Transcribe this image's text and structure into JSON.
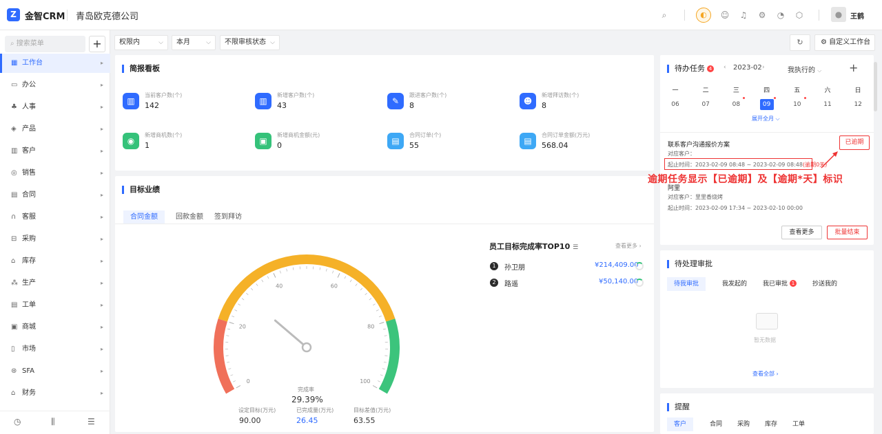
{
  "app": {
    "logo": "Z",
    "name": "金智CRM",
    "company": "青岛欧克德公司",
    "user": "王鹤"
  },
  "topbar_icons": [
    "search-icon",
    "megaphone-icon",
    "contacts-icon",
    "bell-icon",
    "settings-icon",
    "pie-chart-icon",
    "package-icon"
  ],
  "sidebar": {
    "search_placeholder": "搜索菜单",
    "add_label": "+",
    "items": [
      {
        "label": "工作台",
        "icon": "dashboard-icon",
        "active": true
      },
      {
        "label": "办公",
        "icon": "office-icon"
      },
      {
        "label": "人事",
        "icon": "people-icon"
      },
      {
        "label": "产品",
        "icon": "product-icon"
      },
      {
        "label": "客户",
        "icon": "customer-icon"
      },
      {
        "label": "销售",
        "icon": "sales-icon"
      },
      {
        "label": "合同",
        "icon": "contract-icon"
      },
      {
        "label": "客服",
        "icon": "headset-icon"
      },
      {
        "label": "采购",
        "icon": "purchase-icon"
      },
      {
        "label": "库存",
        "icon": "warehouse-icon"
      },
      {
        "label": "生产",
        "icon": "production-icon"
      },
      {
        "label": "工单",
        "icon": "ticket-icon"
      },
      {
        "label": "商城",
        "icon": "store-icon"
      },
      {
        "label": "市场",
        "icon": "market-icon"
      },
      {
        "label": "SFA",
        "icon": "sfa-icon"
      },
      {
        "label": "财务",
        "icon": "finance-icon"
      }
    ]
  },
  "filters": {
    "scope": "权限内",
    "period": "本月",
    "audit": "不限审核状态"
  },
  "toolbar": {
    "custom_label": "自定义工作台"
  },
  "briefing": {
    "title": "简报看板",
    "stats": [
      {
        "label": "当前客户数(个)",
        "value": "142",
        "color": "#2f6bff"
      },
      {
        "label": "新增客户数(个)",
        "value": "43",
        "color": "#2f6bff"
      },
      {
        "label": "跟进客户数(个)",
        "value": "8",
        "color": "#2f6bff"
      },
      {
        "label": "新增拜访数(个)",
        "value": "8",
        "color": "#2f6bff"
      },
      {
        "label": "新增商机数(个)",
        "value": "1",
        "color": "#35c27a"
      },
      {
        "label": "新增商机金额(元)",
        "value": "0",
        "color": "#35c27a"
      },
      {
        "label": "合同订单(个)",
        "value": "55",
        "color": "#3ea8f5"
      },
      {
        "label": "合同订单金额(万元)",
        "value": "568.04",
        "color": "#3ea8f5"
      }
    ]
  },
  "target": {
    "title": "目标业绩",
    "tabs": [
      "合同金额",
      "回款金额",
      "签到拜访"
    ],
    "gauge": {
      "ticks": [
        "0",
        "20",
        "40",
        "60",
        "80",
        "100"
      ],
      "center_label": "完成率",
      "center_value": "29.39%",
      "percent": 29.39,
      "colors": {
        "low": "#f0705a",
        "mid": "#f5b128",
        "high": "#3cc47c"
      }
    },
    "summary": [
      {
        "label": "设定目标(万元)",
        "value": "90.00"
      },
      {
        "label": "已完成量(万元)",
        "value": "26.45"
      },
      {
        "label": "目标差值(万元)",
        "value": "63.55"
      }
    ],
    "top10": {
      "title": "员工目标完成率TOP10",
      "more": "查看更多",
      "rows": [
        {
          "rank": "1",
          "name": "孙卫朋",
          "amount": "¥214,409.00"
        },
        {
          "rank": "2",
          "name": "路遥",
          "amount": "¥50,140.00"
        }
      ]
    }
  },
  "tasks": {
    "title": "待办任务",
    "badge": "4",
    "month": "2023-02",
    "filter": "我执行的",
    "weekdays": [
      "一",
      "二",
      "三",
      "四",
      "五",
      "六",
      "日"
    ],
    "days": [
      "06",
      "07",
      "08",
      "09",
      "10",
      "11",
      "12"
    ],
    "expand": "展开全月",
    "items": [
      {
        "title": "联系客户沟通报价方案",
        "customer": "对应客户：",
        "time": "起止时间：2023-02-09 08:48 ~ 2023-02-09 08:48",
        "overdue": "(逾期0天)",
        "tag": "已逾期"
      },
      {
        "title": "阿里",
        "customer": "对应客户：里里香烧烤",
        "time": "起止时间：2023-02-09 17:34 ~ 2023-02-10 00:00"
      }
    ],
    "view_more": "查看更多",
    "batch_end": "批量结束",
    "annotation": "逾期任务显示【已逾期】及【逾期*天】标识"
  },
  "approvals": {
    "title": "待处理审批",
    "tabs": [
      "待我审批",
      "我发起的",
      "我已审批",
      "抄送我的"
    ],
    "tab_badge": "1",
    "empty": "暂无数据",
    "view_all": "查看全部"
  },
  "reminders": {
    "title": "提醒",
    "tabs": [
      "客户",
      "合同",
      "采购",
      "库存",
      "工单"
    ]
  }
}
